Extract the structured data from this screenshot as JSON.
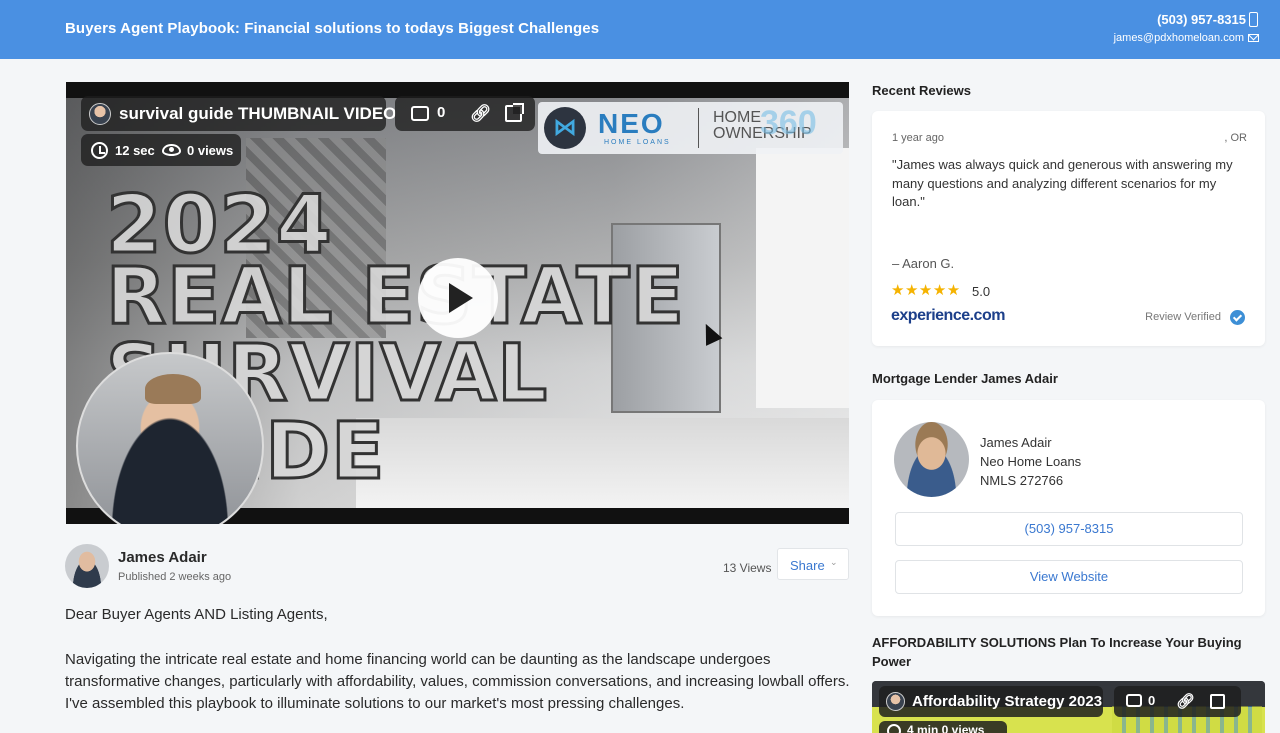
{
  "header": {
    "title": "Buyers Agent Playbook: Financial solutions to todays Biggest Challenges",
    "phone": "(503) 957-8315",
    "email": "james@pdxhomeloan.com",
    "bg_color": "#4a90e2"
  },
  "video": {
    "title": "survival guide THUMBNAIL VIDEO",
    "comments": "0",
    "duration": "12 sec",
    "views": "0 views",
    "thumb_line1": "2024",
    "thumb_line2": "REAL ESTATE",
    "thumb_line3": "SURVIVAL GUIDE",
    "brand_neo": "NEO",
    "brand_neo_sub": "HOME LOANS",
    "brand_home": "HOME",
    "brand_ownership": "OWNERSHIP",
    "brand_360": "360",
    "icons": [
      "comment-icon",
      "link-icon",
      "external-link-icon",
      "clock-icon",
      "eye-icon",
      "play-icon"
    ]
  },
  "author": {
    "name": "James Adair",
    "published": "Published 2 weeks ago",
    "views": "13 Views",
    "share_label": "Share",
    "share_caret": "⌄"
  },
  "body": {
    "greeting": "Dear Buyer Agents AND Listing Agents,",
    "paragraph1": "Navigating the intricate real estate and home financing world can be daunting as the landscape undergoes transformative changes, particularly with affordability, values, commission conversations, and increasing lowball offers. I've assembled this playbook to illuminate solutions to our market's most pressing challenges."
  },
  "reviews": {
    "section_title": "Recent Reviews",
    "date": "1 year ago",
    "location": ", OR",
    "quote": "\"James was always quick and generous with answering my many questions and analyzing different scenarios for my loan.\"",
    "reviewer": "– Aaron G.",
    "stars": "★★★★★",
    "rating": "5.0",
    "source_logo": "experience.com",
    "verified_label": "Review Verified",
    "star_color": "#f5b301"
  },
  "lender": {
    "section_title": "Mortgage Lender James Adair",
    "name": "James Adair",
    "company": "Neo Home Loans",
    "nmls": "NMLS 272766",
    "phone_button": "(503) 957-8315",
    "website_button": "View Website"
  },
  "affordability": {
    "section_title": "AFFORDABILITY SOLUTIONS Plan To Increase Your Buying Power",
    "video_title": "Affordability Strategy 2023",
    "comments": "0",
    "meta": "4 min   0 views"
  }
}
